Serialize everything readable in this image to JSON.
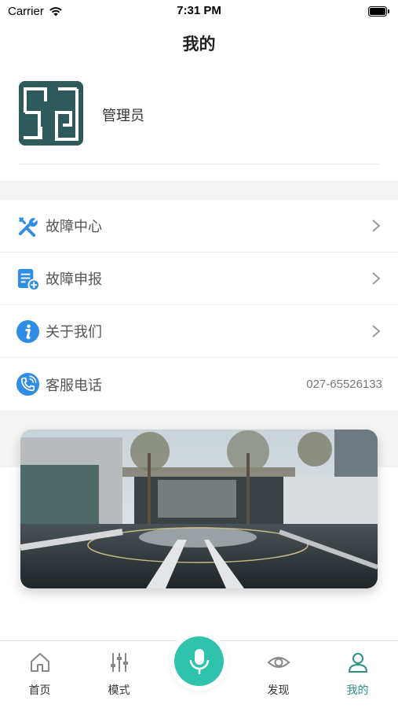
{
  "status_bar": {
    "carrier": "Carrier",
    "time": "7:31 PM"
  },
  "header": {
    "title": "我的"
  },
  "profile": {
    "username": "管理员"
  },
  "menu": {
    "items": [
      {
        "label": "故障中心",
        "icon": "tools-icon"
      },
      {
        "label": "故障申报",
        "icon": "report-icon"
      },
      {
        "label": "关于我们",
        "icon": "info-icon"
      },
      {
        "label": "客服电话",
        "icon": "phone-icon",
        "value": "027-65526133"
      }
    ]
  },
  "tabbar": {
    "tabs": [
      {
        "label": "首页",
        "icon": "home-icon"
      },
      {
        "label": "模式",
        "icon": "sliders-icon"
      },
      {
        "label": "发现",
        "icon": "eye-icon"
      },
      {
        "label": "我的",
        "icon": "user-icon",
        "active": true
      }
    ],
    "center_button_icon": "microphone-icon"
  },
  "colors": {
    "accent": "#2e8e86",
    "mic": "#2fc3ad",
    "icon_blue": "#2f8de4",
    "avatar_bg": "#2f5a5c"
  }
}
